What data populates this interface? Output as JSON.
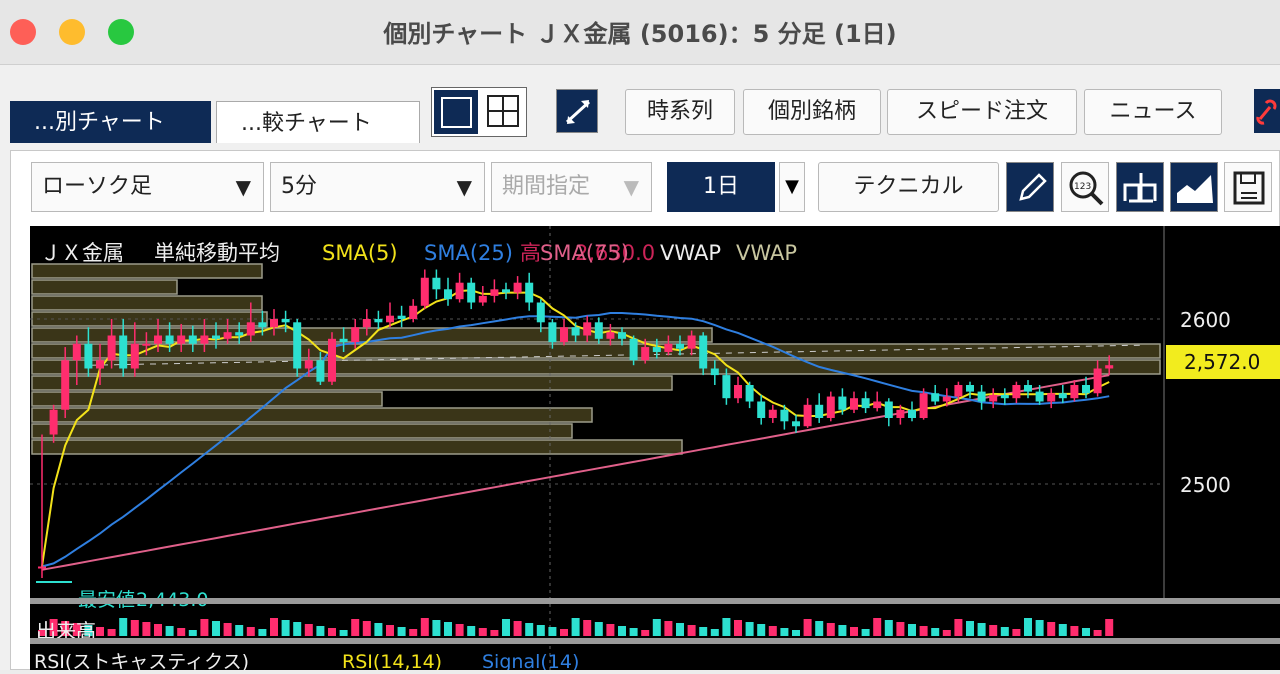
{
  "window": {
    "title": "個別チャート ＪＸ金属 (5016)：5 分足 (1日)"
  },
  "tabs": [
    {
      "label": "...別チャート"
    },
    {
      "label": "...較チャート"
    }
  ],
  "toolbar": {
    "time_series": "時系列",
    "individual_stock": "個別銘柄",
    "speed_order": "スピード注文",
    "news": "ニュース"
  },
  "controls": {
    "chart_type": "ローソク足",
    "interval": "5分",
    "period": "期間指定",
    "range": "1日",
    "technical": "テクニカル"
  },
  "legend": {
    "stock": "ＪＸ金属",
    "indicator": "単純移動平均",
    "sma5": "SMA(5)",
    "sma25": "SMA(25)",
    "sma75": "SMA(75)",
    "vwap1": "VWAP",
    "vwap2": "VWAP",
    "high_label": "高",
    "high_value": "2,630.0"
  },
  "price_axis": {
    "tick_2600": "2600",
    "tick_2500": "2500",
    "current": "2,572.0"
  },
  "low_label": "最安値",
  "low_value": "2,443.0",
  "volume_label": "出来高",
  "rsi_label": "RSI(ストキャスティクス)",
  "rsi_main": "RSI(14,14)",
  "rsi_signal": "Signal(14)",
  "colors": {
    "up": "#ff2d6e",
    "down": "#2de0d0",
    "sma5": "#f2e21a",
    "sma25": "#2f7fe0",
    "sma75": "#e0608a",
    "vwap": "#c8c6a0",
    "current_bg": "#f2ec1e"
  },
  "chart_data": {
    "type": "candlestick",
    "interval": "5分",
    "y_ticks": [
      2500,
      2600
    ],
    "current_price": 2572.0,
    "day_high": 2630.0,
    "day_low": 2443.0,
    "candles": [
      [
        2450,
        2450,
        2530,
        2443
      ],
      [
        2530,
        2545,
        2548,
        2525
      ],
      [
        2545,
        2575,
        2583,
        2540
      ],
      [
        2575,
        2585,
        2590,
        2560
      ],
      [
        2585,
        2570,
        2595,
        2565
      ],
      [
        2570,
        2575,
        2585,
        2560
      ],
      [
        2575,
        2590,
        2600,
        2570
      ],
      [
        2590,
        2570,
        2600,
        2565
      ],
      [
        2570,
        2585,
        2598,
        2565
      ],
      [
        2585,
        2585,
        2592,
        2578
      ],
      [
        2585,
        2590,
        2600,
        2580
      ],
      [
        2590,
        2585,
        2598,
        2580
      ],
      [
        2585,
        2590,
        2597,
        2580
      ],
      [
        2590,
        2585,
        2596,
        2580
      ],
      [
        2585,
        2590,
        2600,
        2580
      ],
      [
        2590,
        2588,
        2598,
        2582
      ],
      [
        2588,
        2592,
        2600,
        2585
      ],
      [
        2592,
        2590,
        2598,
        2585
      ],
      [
        2590,
        2598,
        2610,
        2586
      ],
      [
        2598,
        2595,
        2605,
        2590
      ],
      [
        2595,
        2600,
        2606,
        2590
      ],
      [
        2600,
        2598,
        2605,
        2592
      ],
      [
        2598,
        2570,
        2600,
        2565
      ],
      [
        2570,
        2575,
        2582,
        2565
      ],
      [
        2575,
        2562,
        2580,
        2560
      ],
      [
        2562,
        2588,
        2592,
        2560
      ],
      [
        2588,
        2586,
        2595,
        2580
      ],
      [
        2586,
        2595,
        2600,
        2582
      ],
      [
        2595,
        2600,
        2606,
        2590
      ],
      [
        2600,
        2598,
        2605,
        2594
      ],
      [
        2598,
        2602,
        2610,
        2595
      ],
      [
        2602,
        2600,
        2608,
        2595
      ],
      [
        2600,
        2608,
        2612,
        2598
      ],
      [
        2608,
        2625,
        2630,
        2606
      ],
      [
        2625,
        2618,
        2630,
        2612
      ],
      [
        2618,
        2612,
        2625,
        2608
      ],
      [
        2612,
        2622,
        2628,
        2610
      ],
      [
        2622,
        2610,
        2625,
        2606
      ],
      [
        2610,
        2614,
        2620,
        2608
      ],
      [
        2614,
        2618,
        2624,
        2610
      ],
      [
        2618,
        2616,
        2622,
        2612
      ],
      [
        2616,
        2622,
        2626,
        2612
      ],
      [
        2622,
        2610,
        2628,
        2605
      ],
      [
        2610,
        2598,
        2612,
        2592
      ],
      [
        2598,
        2586,
        2600,
        2582
      ],
      [
        2586,
        2595,
        2600,
        2584
      ],
      [
        2595,
        2590,
        2598,
        2586
      ],
      [
        2590,
        2598,
        2602,
        2586
      ],
      [
        2598,
        2588,
        2601,
        2585
      ],
      [
        2588,
        2592,
        2597,
        2584
      ],
      [
        2592,
        2588,
        2595,
        2584
      ],
      [
        2588,
        2575,
        2590,
        2572
      ],
      [
        2575,
        2583,
        2588,
        2573
      ],
      [
        2583,
        2580,
        2588,
        2576
      ],
      [
        2580,
        2585,
        2590,
        2578
      ],
      [
        2585,
        2582,
        2590,
        2578
      ],
      [
        2582,
        2590,
        2593,
        2578
      ],
      [
        2590,
        2570,
        2592,
        2566
      ],
      [
        2570,
        2566,
        2575,
        2560
      ],
      [
        2566,
        2552,
        2570,
        2548
      ],
      [
        2552,
        2560,
        2565,
        2549
      ],
      [
        2560,
        2550,
        2562,
        2546
      ],
      [
        2550,
        2540,
        2554,
        2536
      ],
      [
        2540,
        2545,
        2548,
        2537
      ],
      [
        2545,
        2538,
        2548,
        2533
      ],
      [
        2538,
        2535,
        2542,
        2531
      ],
      [
        2535,
        2548,
        2552,
        2534
      ],
      [
        2548,
        2540,
        2555,
        2537
      ],
      [
        2540,
        2553,
        2556,
        2538
      ],
      [
        2553,
        2545,
        2558,
        2542
      ],
      [
        2545,
        2552,
        2556,
        2543
      ],
      [
        2552,
        2546,
        2556,
        2543
      ],
      [
        2546,
        2550,
        2556,
        2544
      ],
      [
        2550,
        2540,
        2552,
        2535
      ],
      [
        2540,
        2545,
        2548,
        2536
      ],
      [
        2545,
        2540,
        2550,
        2538
      ],
      [
        2540,
        2555,
        2558,
        2539
      ],
      [
        2555,
        2550,
        2560,
        2548
      ],
      [
        2550,
        2553,
        2558,
        2547
      ],
      [
        2553,
        2560,
        2562,
        2550
      ],
      [
        2560,
        2556,
        2562,
        2552
      ],
      [
        2556,
        2550,
        2560,
        2545
      ],
      [
        2550,
        2554,
        2558,
        2546
      ],
      [
        2554,
        2552,
        2558,
        2548
      ],
      [
        2552,
        2560,
        2562,
        2549
      ],
      [
        2560,
        2556,
        2563,
        2552
      ],
      [
        2556,
        2550,
        2560,
        2548
      ],
      [
        2550,
        2555,
        2558,
        2546
      ],
      [
        2555,
        2552,
        2560,
        2549
      ],
      [
        2552,
        2560,
        2563,
        2550
      ],
      [
        2560,
        2555,
        2565,
        2552
      ],
      [
        2555,
        2570,
        2575,
        2553
      ],
      [
        2570,
        2572,
        2578,
        2566
      ]
    ]
  }
}
